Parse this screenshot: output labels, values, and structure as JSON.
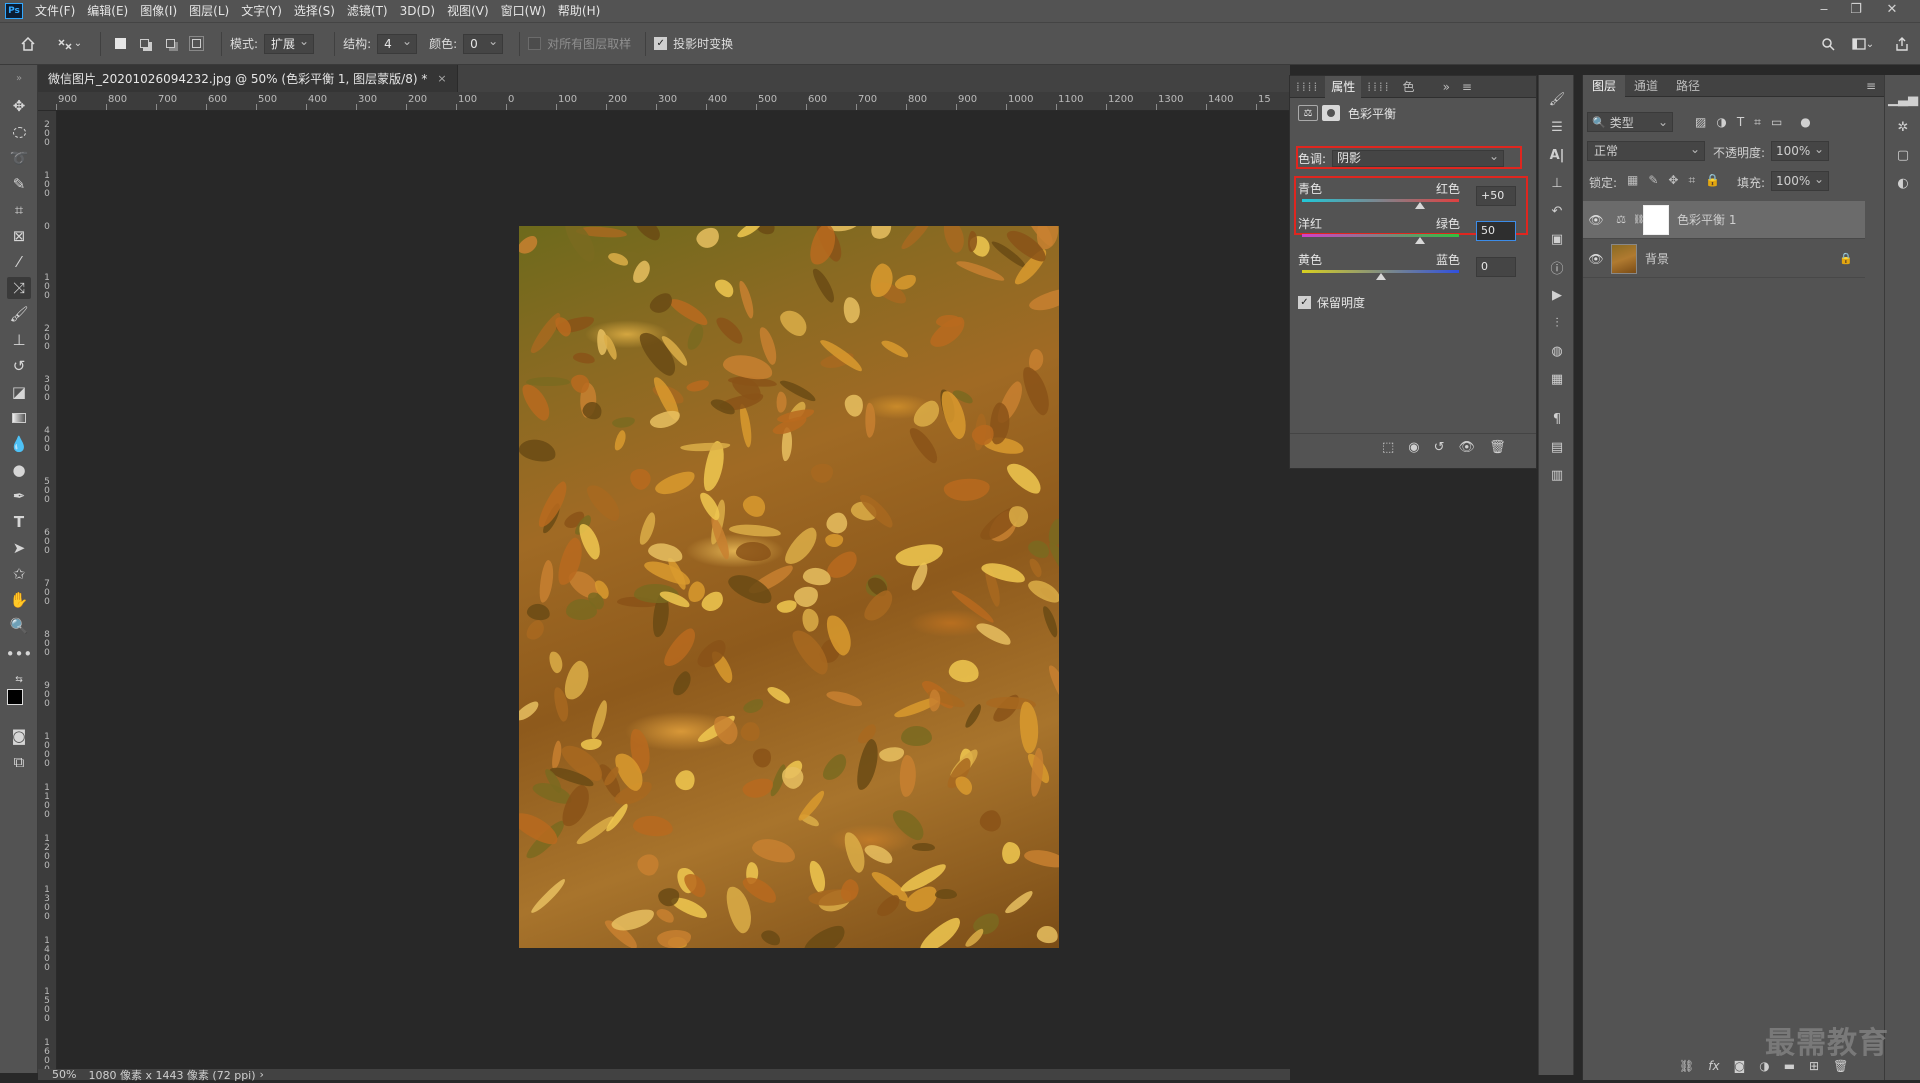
{
  "menubar": {
    "logo": "Ps",
    "items": [
      "文件(F)",
      "编辑(E)",
      "图像(I)",
      "图层(L)",
      "文字(Y)",
      "选择(S)",
      "滤镜(T)",
      "3D(D)",
      "视图(V)",
      "窗口(W)",
      "帮助(H)"
    ]
  },
  "options": {
    "mode_label": "模式:",
    "mode_value": "扩展",
    "structure_label": "结构:",
    "structure_value": "4",
    "color_label": "颜色:",
    "color_value": "0",
    "sample_all_label": "对所有图层取样",
    "sample_all_checked": false,
    "transform_label": "投影时变换",
    "transform_checked": true
  },
  "document": {
    "tab_title": "微信图片_20201026094232.jpg @ 50% (色彩平衡 1, 图层蒙版/8) *",
    "close": "×"
  },
  "ruler": {
    "h_labels": [
      "900",
      "800",
      "700",
      "600",
      "500",
      "400",
      "300",
      "200",
      "100",
      "0",
      "100",
      "200",
      "300",
      "400",
      "500",
      "600",
      "700",
      "800",
      "900",
      "1000",
      "1100",
      "1200",
      "1300",
      "1400",
      "15"
    ],
    "v_labels": [
      "2 0 0",
      "1 0 0",
      "0",
      "1 0 0",
      "2 0 0",
      "3 0 0",
      "4 0 0",
      "5 0 0",
      "6 0 0",
      "7 0 0",
      "8 0 0",
      "9 0 0",
      "1 0 0 0",
      "1 1 0 0",
      "1 2 0 0",
      "1 3 0 0",
      "1 4 0 0",
      "1 5 0 0",
      "1 6 0 0"
    ]
  },
  "status": {
    "zoom": "50%",
    "doc_info": "1080 像素 x 1443 像素 (72 ppi)",
    "arrow": "›"
  },
  "properties": {
    "tabs": [
      "属性",
      "色"
    ],
    "panel_title": "色彩平衡",
    "tone_label": "色调:",
    "tone_value": "阴影",
    "sliders": [
      {
        "left": "青色",
        "right": "红色",
        "value": "+50",
        "fraction": 0.75
      },
      {
        "left": "洋红",
        "right": "绿色",
        "value": "50",
        "fraction": 0.75
      },
      {
        "left": "黄色",
        "right": "蓝色",
        "value": "0",
        "fraction": 0.5
      }
    ],
    "preserve_label": "保留明度",
    "preserve_checked": true
  },
  "layers": {
    "tabs": [
      "图层",
      "通道",
      "路径"
    ],
    "filter_label": "类型",
    "blend_mode": "正常",
    "opacity_label": "不透明度:",
    "opacity_value": "100%",
    "lock_label": "锁定:",
    "fill_label": "填充:",
    "fill_value": "100%",
    "items": [
      {
        "name": "色彩平衡 1"
      },
      {
        "name": "背景"
      }
    ]
  },
  "watermark": "最需教育",
  "colors": {
    "highlight": "#e0261f",
    "accent": "#31a8ff",
    "panel": "#535353",
    "canvas": "#282828"
  }
}
